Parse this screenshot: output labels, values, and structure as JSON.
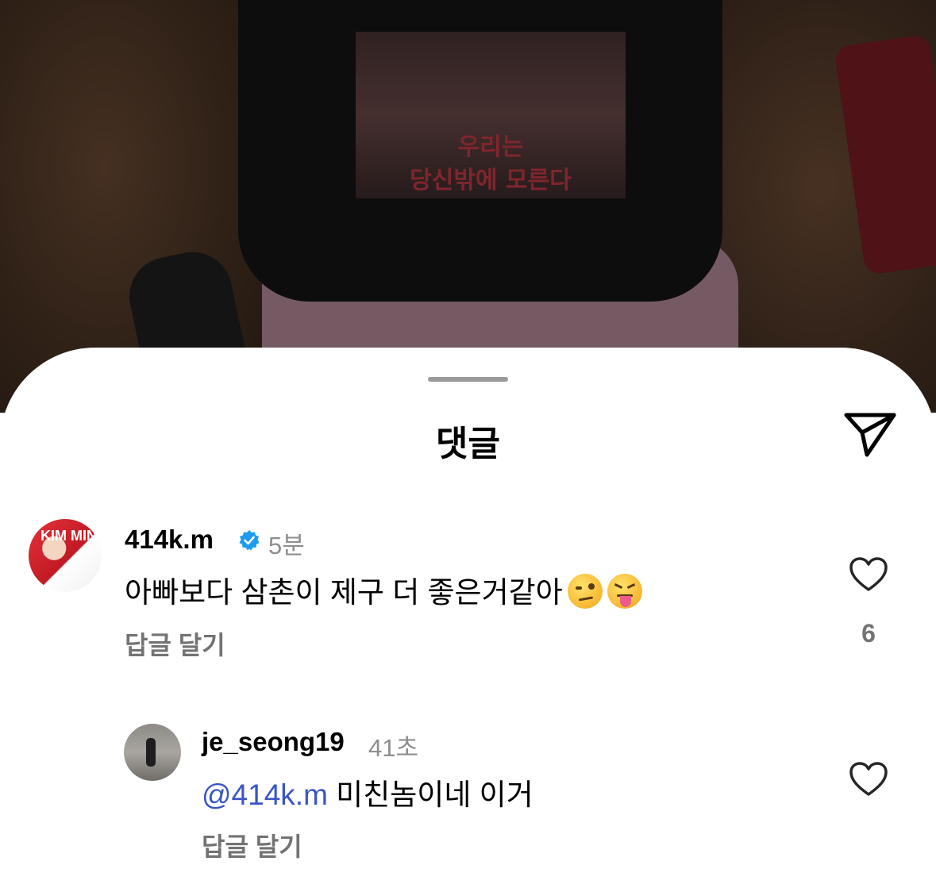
{
  "background": {
    "shirt_print_line1": "우리는",
    "shirt_print_line2": "당신밖에 모른다"
  },
  "sheet": {
    "title": "댓글",
    "share_icon": "paper-plane-icon"
  },
  "comments": [
    {
      "username": "414k.m",
      "verified": true,
      "time": "5분",
      "text": "아빠보다 삼촌이 제구 더 좋은거같아",
      "emojis": [
        "woozy-face-icon",
        "squinting-tongue-face-icon"
      ],
      "reply_label": "답글 달기",
      "like_count": "6",
      "avatar_text": "KIM MIN"
    },
    {
      "username": "je_seong19",
      "verified": false,
      "time": "41초",
      "mention": "@414k.m",
      "text": " 미친놈이네 이거",
      "reply_label": "답글 달기"
    }
  ],
  "colors": {
    "mention": "#3a55c4",
    "secondary_text": "#8e8e8e",
    "verified_badge": "#1d9bf0"
  }
}
